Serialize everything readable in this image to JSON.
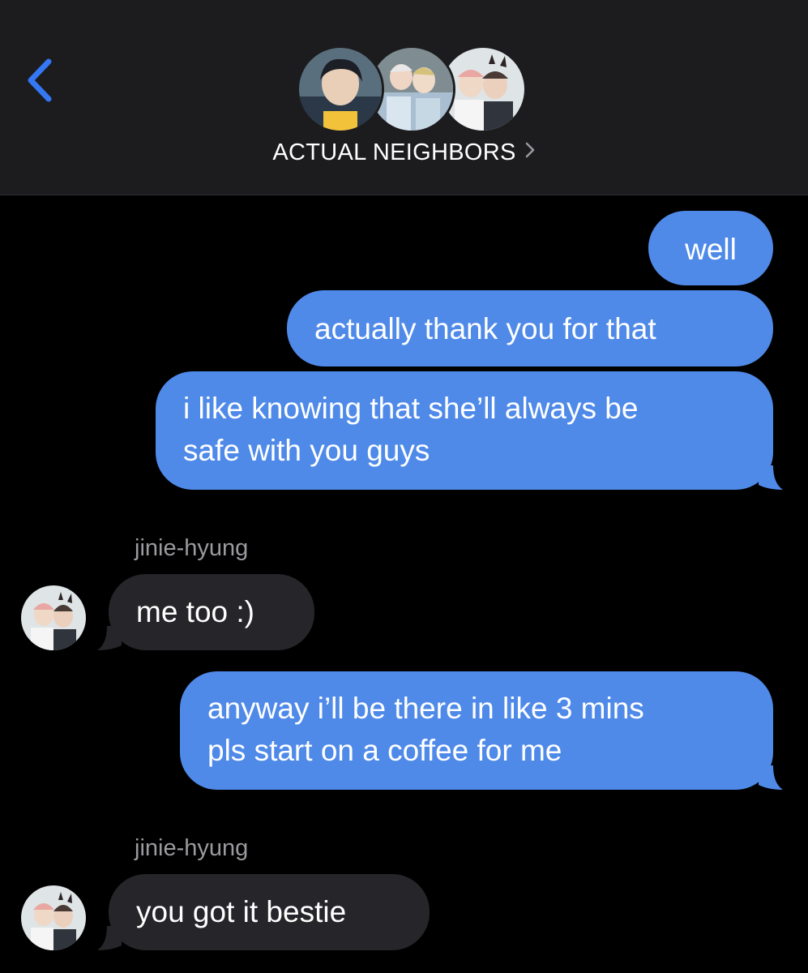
{
  "header": {
    "title": "ACTUAL NEIGHBORS",
    "back_icon": "chevron-left-icon",
    "disclosure_icon": "chevron-right-icon",
    "accent_color": "#3478f6",
    "background": "#1c1c1e"
  },
  "colors": {
    "outgoing_bubble": "#4f8ae9",
    "incoming_bubble": "#26262a",
    "sender_label": "#9a9a9f",
    "background": "#000000"
  },
  "messages": [
    {
      "direction": "outgoing",
      "text": "well"
    },
    {
      "direction": "outgoing",
      "text": "actually thank you for that"
    },
    {
      "direction": "outgoing",
      "lines": [
        "i like knowing that she’ll always be",
        "safe with you guys"
      ]
    },
    {
      "direction": "incoming",
      "sender": "jinie-hyung",
      "text": "me too :)"
    },
    {
      "direction": "outgoing",
      "lines": [
        "anyway i’ll be there in like 3 mins",
        "pls start on a coffee for me"
      ]
    },
    {
      "direction": "incoming",
      "sender": "jinie-hyung",
      "text": "you got it bestie"
    }
  ]
}
